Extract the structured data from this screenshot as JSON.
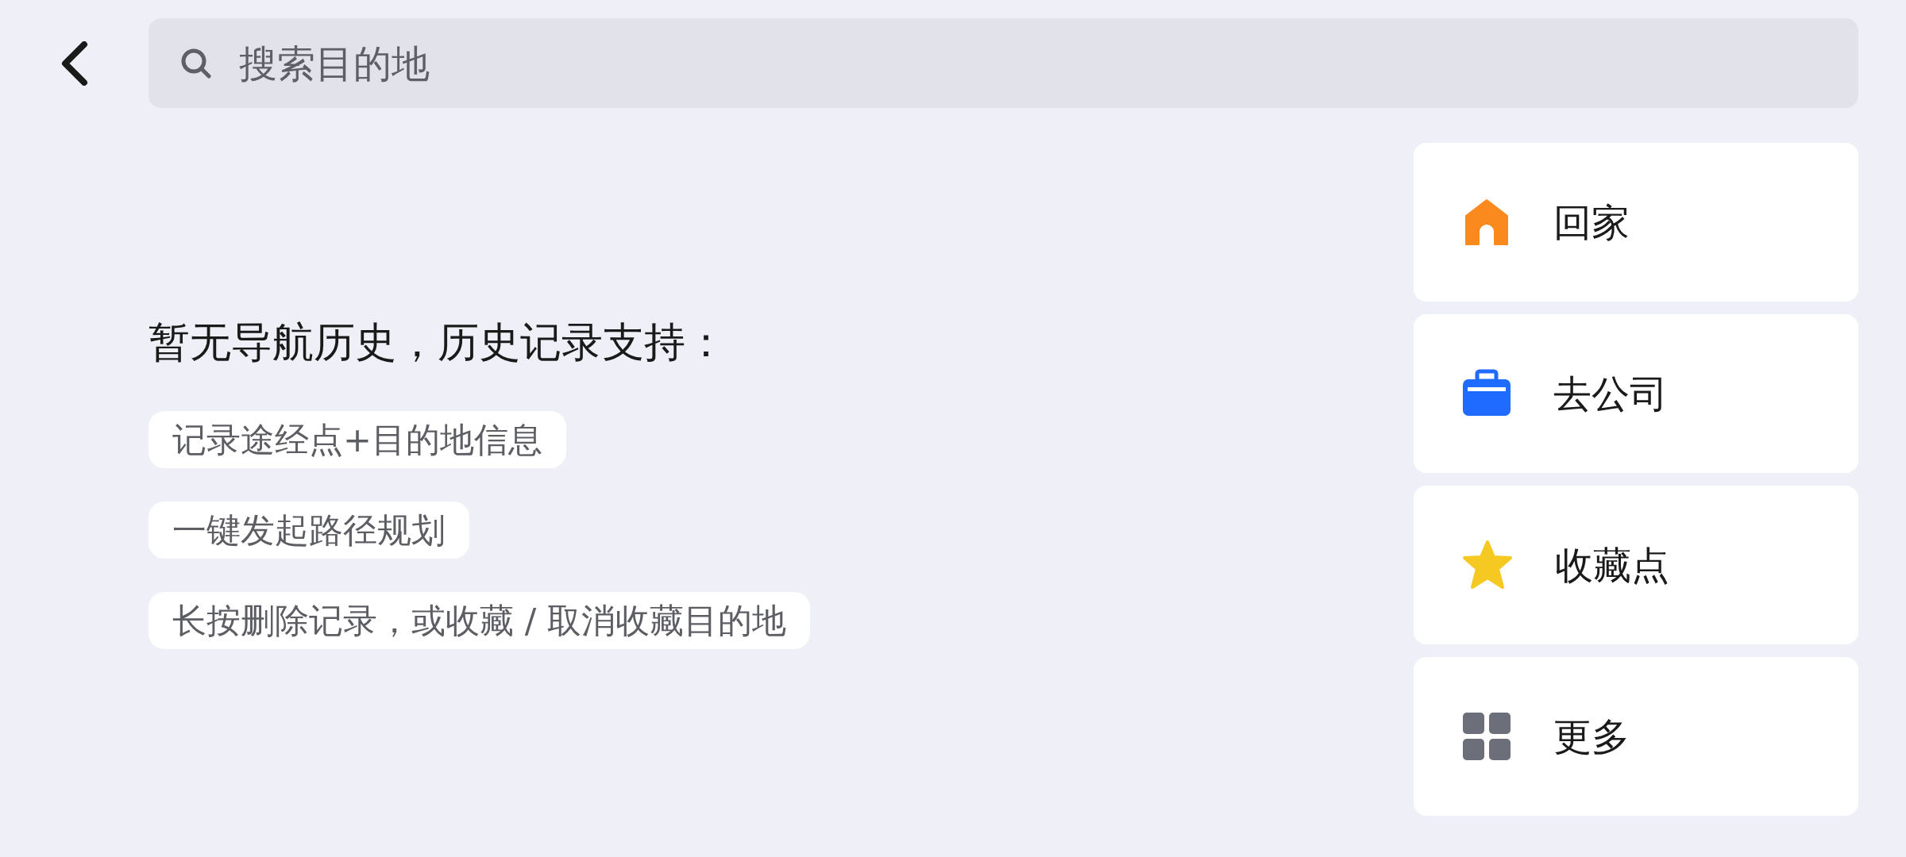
{
  "search": {
    "placeholder": "搜索目的地"
  },
  "empty_history": {
    "title": "暂无导航历史，历史记录支持：",
    "tips": [
      "记录途经点+目的地信息",
      "一键发起路径规划",
      "长按删除记录，或收藏 / 取消收藏目的地"
    ]
  },
  "shortcuts": [
    {
      "label": "回家",
      "kind": "home"
    },
    {
      "label": "去公司",
      "kind": "work"
    },
    {
      "label": "收藏点",
      "kind": "favorites"
    },
    {
      "label": "更多",
      "kind": "more"
    }
  ]
}
